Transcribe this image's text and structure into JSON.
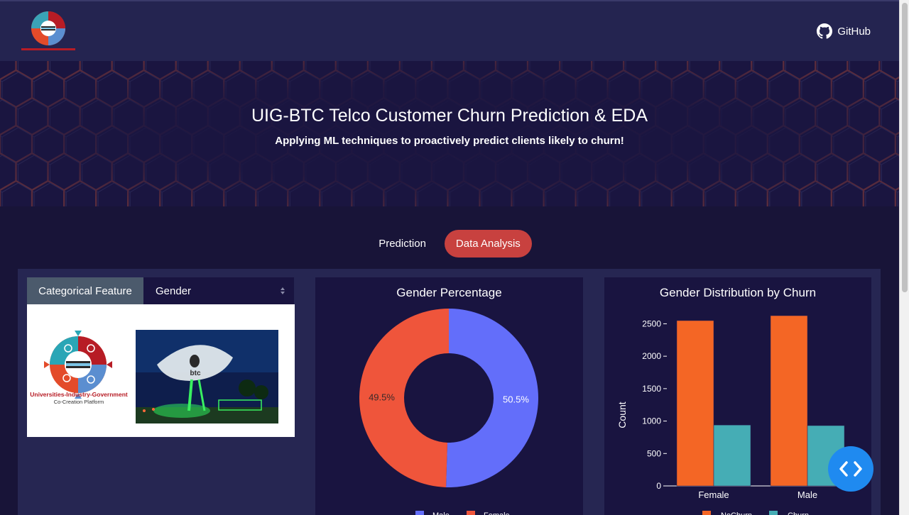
{
  "navbar": {
    "github_label": "GitHub"
  },
  "hero": {
    "title": "UIG-BTC Telco Customer Churn Prediction & EDA",
    "subtitle": "Applying ML techniques to proactively predict clients likely to churn!"
  },
  "tabs": [
    {
      "label": "Prediction",
      "active": false
    },
    {
      "label": "Data Analysis",
      "active": true
    }
  ],
  "selector": {
    "label": "Categorical Feature",
    "value": "Gender"
  },
  "images": {
    "uig_caption_line1": "Universities-Industry-Government",
    "uig_caption_line2": "Co-Creation Platform",
    "btc_text": "btc"
  },
  "colors": {
    "accent": "#c8413f",
    "male": "#636efa",
    "female": "#ef553b",
    "nochurn": "#f46625",
    "churn": "#45adb5"
  },
  "chart_data": [
    {
      "type": "pie",
      "title": "Gender Percentage",
      "hole": true,
      "labels": [
        "Male",
        "Female"
      ],
      "values": [
        50.5,
        49.5
      ],
      "value_labels": [
        "50.5%",
        "49.5%"
      ],
      "legend": "bottom"
    },
    {
      "type": "bar",
      "title": "Gender Distribution by Churn",
      "categories": [
        "Female",
        "Male"
      ],
      "series": [
        {
          "name": "NoChurn",
          "values": [
            2549,
            2625
          ]
        },
        {
          "name": "Churn",
          "values": [
            939,
            930
          ]
        }
      ],
      "ylabel": "Count",
      "yticks": [
        0,
        500,
        1000,
        1500,
        2000,
        2500
      ],
      "ylim": [
        0,
        2625
      ],
      "legend": "bottom"
    }
  ]
}
